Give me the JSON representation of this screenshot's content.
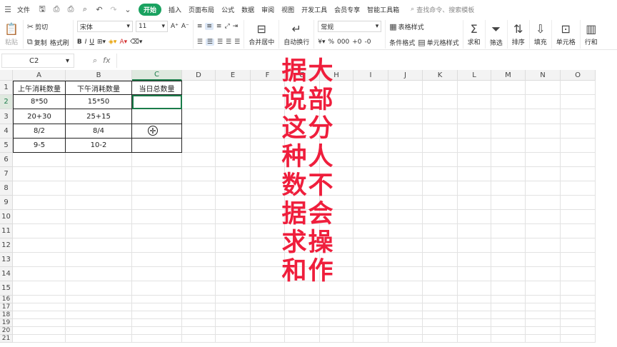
{
  "menubar": {
    "file": "文件",
    "tabs": [
      "开始",
      "插入",
      "页面布局",
      "公式",
      "数据",
      "审阅",
      "视图",
      "开发工具",
      "会员专享",
      "智能工具箱"
    ],
    "active_tab": "开始",
    "search_placeholder": "查找命令、搜索模板"
  },
  "ribbon": {
    "paste": "粘贴",
    "cut": "剪切",
    "copy": "复制",
    "format_painter": "格式刷",
    "font_name": "宋体",
    "font_size": "11",
    "bold": "B",
    "italic": "I",
    "underline": "U",
    "merge_center": "合并居中",
    "wrap_text": "自动换行",
    "number_format": "常规",
    "conditional_format": "条件格式",
    "table_style": "表格样式",
    "cell_style": "单元格样式",
    "sum": "求和",
    "filter": "筛选",
    "sort": "排序",
    "fill": "填充",
    "cell": "单元格",
    "row_col": "行和"
  },
  "formula_bar": {
    "name_box": "C2",
    "fx": "fx",
    "value": ""
  },
  "sheet": {
    "columns": [
      "A",
      "B",
      "C",
      "D",
      "E",
      "F",
      "G",
      "H",
      "I",
      "J",
      "K",
      "L",
      "M",
      "N",
      "O"
    ],
    "rows": [
      "1",
      "2",
      "3",
      "4",
      "5",
      "6",
      "7",
      "8",
      "9",
      "10",
      "11",
      "12",
      "13",
      "14",
      "15",
      "16",
      "17",
      "18",
      "19",
      "20",
      "21"
    ],
    "selected_column": "C",
    "selected_row": "2",
    "table": [
      [
        "上午消耗数量",
        "下午消耗数量",
        "当日总数量"
      ],
      [
        "8*50",
        "15*50",
        ""
      ],
      [
        "20+30",
        "25+15",
        ""
      ],
      [
        "8/2",
        "8/4",
        ""
      ],
      [
        "9-5",
        "10-2",
        ""
      ]
    ]
  },
  "overlay_text": {
    "left_column": [
      "据",
      "说",
      "这",
      "种",
      "数",
      "据",
      "求",
      "和"
    ],
    "right_column": [
      "大",
      "部",
      "分",
      "人",
      "不",
      "会",
      "操",
      "作"
    ]
  }
}
